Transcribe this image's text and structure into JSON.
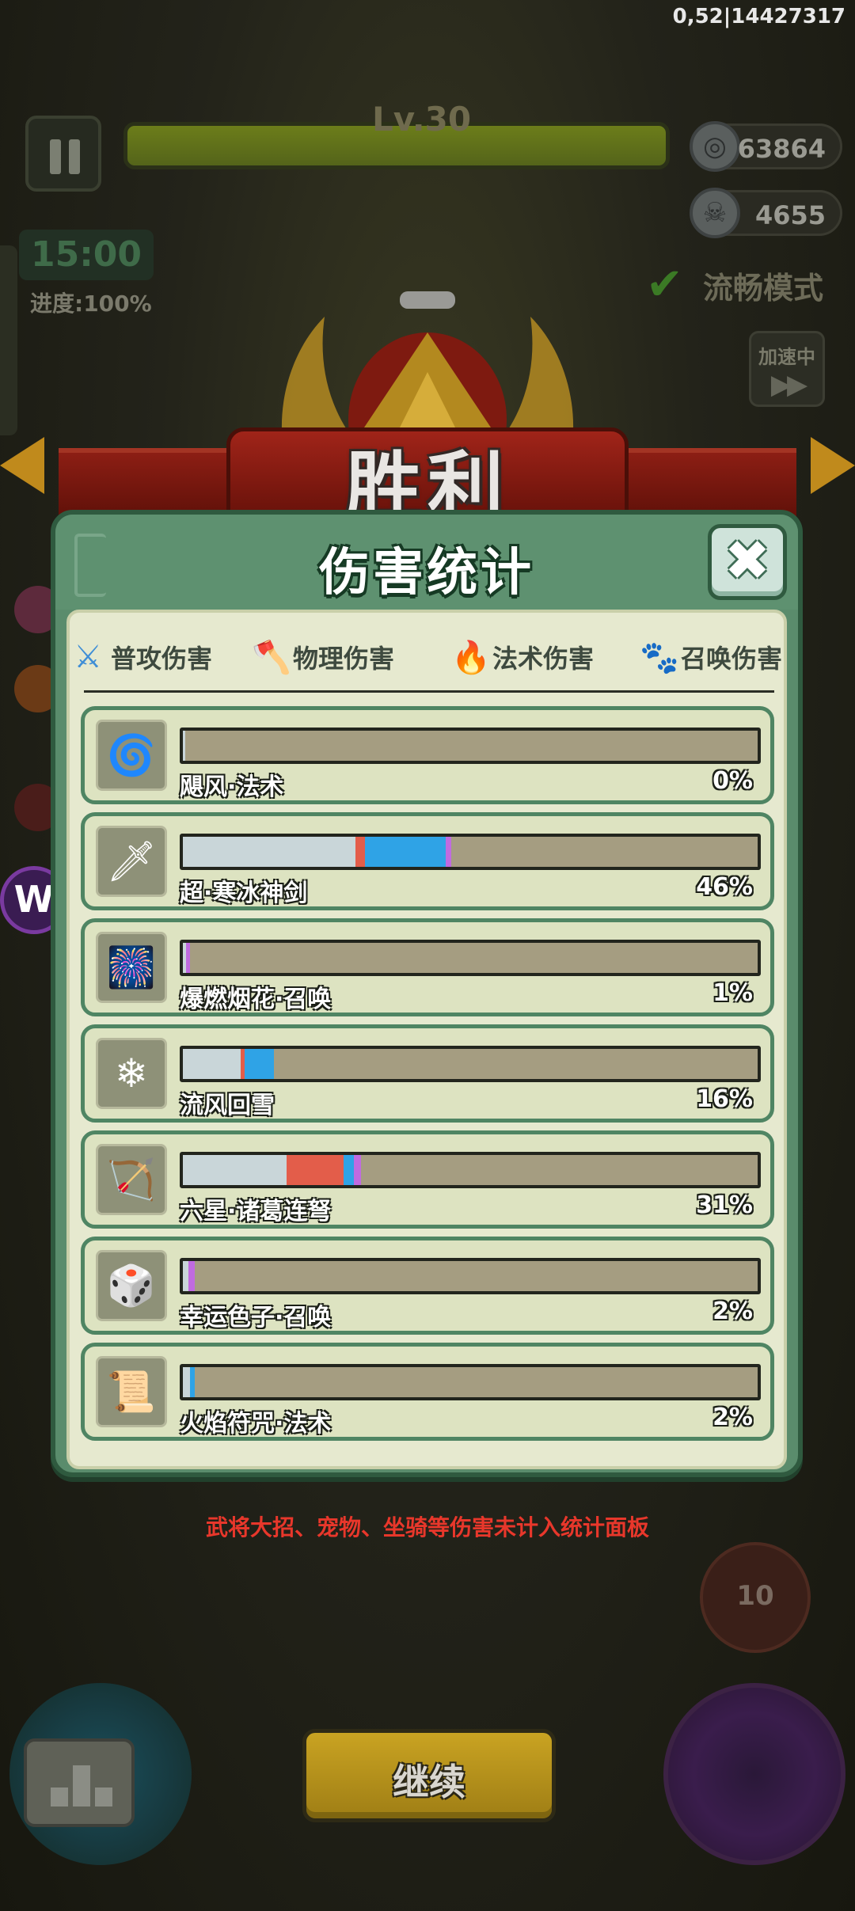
{
  "debug": {
    "text": "0,52|14427317"
  },
  "hud": {
    "level": "Lv.30",
    "coins": "63864",
    "kills": "4655",
    "timer": "15:00",
    "progress": "进度:100%",
    "smooth_mode": "流畅模式",
    "speed_label": "加速中",
    "speed_icon": "▶▶"
  },
  "banner": {
    "title": "胜利"
  },
  "dialog": {
    "title": "伤害统计",
    "close_icon": "✖",
    "legend": [
      {
        "label": "普攻伤害",
        "icon": "sword-icon",
        "glyph": "⚔",
        "color": "#3f8ed6"
      },
      {
        "label": "物理伤害",
        "icon": "axe-icon",
        "glyph": "🪓",
        "color": "#e53935"
      },
      {
        "label": "法术伤害",
        "icon": "flame-icon",
        "glyph": "🔥",
        "color": "#1e88e5"
      },
      {
        "label": "召唤伤害",
        "icon": "paw-icon",
        "glyph": "🐾",
        "color": "#b15bd6"
      }
    ],
    "rows": [
      {
        "name": "飓风·法术",
        "percent": "0%",
        "icon": "tornado-icon",
        "glyph": "🌀",
        "segments": [
          {
            "type": "basic",
            "value": 0.004
          }
        ]
      },
      {
        "name": "超·寒冰神剑",
        "percent": "46%",
        "icon": "ice-sword-icon",
        "glyph": "🗡",
        "segments": [
          {
            "type": "basic",
            "value": 0.3
          },
          {
            "type": "physical",
            "value": 0.017
          },
          {
            "type": "magic",
            "value": 0.14
          },
          {
            "type": "summon",
            "value": 0.01
          }
        ]
      },
      {
        "name": "爆燃烟花·召唤",
        "percent": "1%",
        "icon": "firework-icon",
        "glyph": "🎆",
        "segments": [
          {
            "type": "basic",
            "value": 0.005
          },
          {
            "type": "summon",
            "value": 0.008
          }
        ]
      },
      {
        "name": "流风回雪",
        "percent": "16%",
        "icon": "snow-fan-icon",
        "glyph": "❄",
        "segments": [
          {
            "type": "basic",
            "value": 0.1
          },
          {
            "type": "physical",
            "value": 0.008
          },
          {
            "type": "magic",
            "value": 0.05
          }
        ]
      },
      {
        "name": "六星·诸葛连弩",
        "percent": "31%",
        "icon": "crossbow-icon",
        "glyph": "🏹",
        "segments": [
          {
            "type": "basic",
            "value": 0.18
          },
          {
            "type": "physical",
            "value": 0.1
          },
          {
            "type": "magic",
            "value": 0.018
          },
          {
            "type": "summon",
            "value": 0.012
          }
        ]
      },
      {
        "name": "幸运色子·召唤",
        "percent": "2%",
        "icon": "dice-icon",
        "glyph": "🎲",
        "segments": [
          {
            "type": "basic",
            "value": 0.01
          },
          {
            "type": "summon",
            "value": 0.01
          }
        ]
      },
      {
        "name": "火焰符咒·法术",
        "percent": "2%",
        "icon": "fire-talisman-icon",
        "glyph": "📜",
        "segments": [
          {
            "type": "basic",
            "value": 0.012
          },
          {
            "type": "magic",
            "value": 0.008
          }
        ]
      }
    ],
    "segment_colors": {
      "basic": "#c9d6d9",
      "physical": "#e35d4a",
      "magic": "#2fa3e6",
      "summon": "#c06be0"
    }
  },
  "footnote": "武将大招、宠物、坐骑等伤害未计入统计面板",
  "bottom": {
    "continue_label": "继续",
    "cooldown": "10",
    "badge": "W"
  }
}
